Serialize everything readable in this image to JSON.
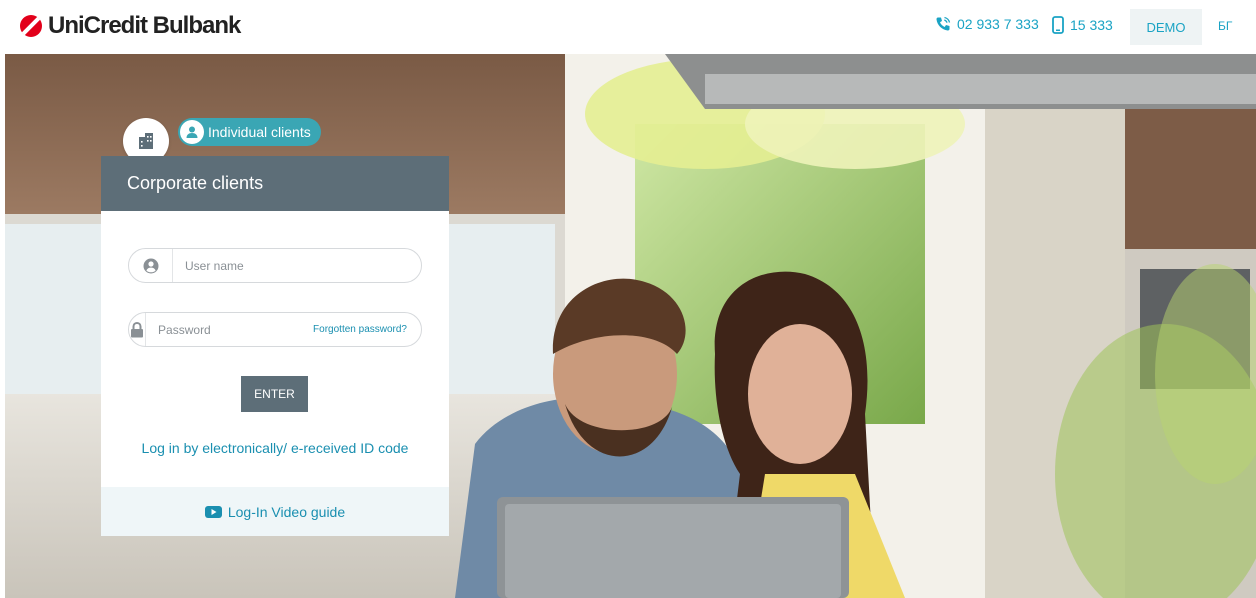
{
  "brand": {
    "name": "UniCredit Bulbank",
    "accent": "#e2001a"
  },
  "header": {
    "phone_1": "02 933 7 333",
    "phone_2": "15 333",
    "demo_label": "DEMO",
    "language_label": "БГ",
    "link_color": "#1aa3c4"
  },
  "login": {
    "active_tab_label": "Corporate clients",
    "other_tab_label": "Individual clients",
    "username_placeholder": "User name",
    "password_placeholder": "Password",
    "forgot_label": "Forgotten password?",
    "enter_label": "ENTER",
    "eid_link_label": "Log in by electronically/ e-received ID code",
    "video_label": "Log-In Video guide",
    "head_color": "#5d6e78",
    "tab_color": "#3aa6b4"
  },
  "icons": {
    "building": "building-icon",
    "person": "person-icon",
    "user": "user-circle-icon",
    "lock": "lock-icon",
    "phone": "phone-icon",
    "mobile": "mobile-icon",
    "video": "video-play-icon"
  }
}
